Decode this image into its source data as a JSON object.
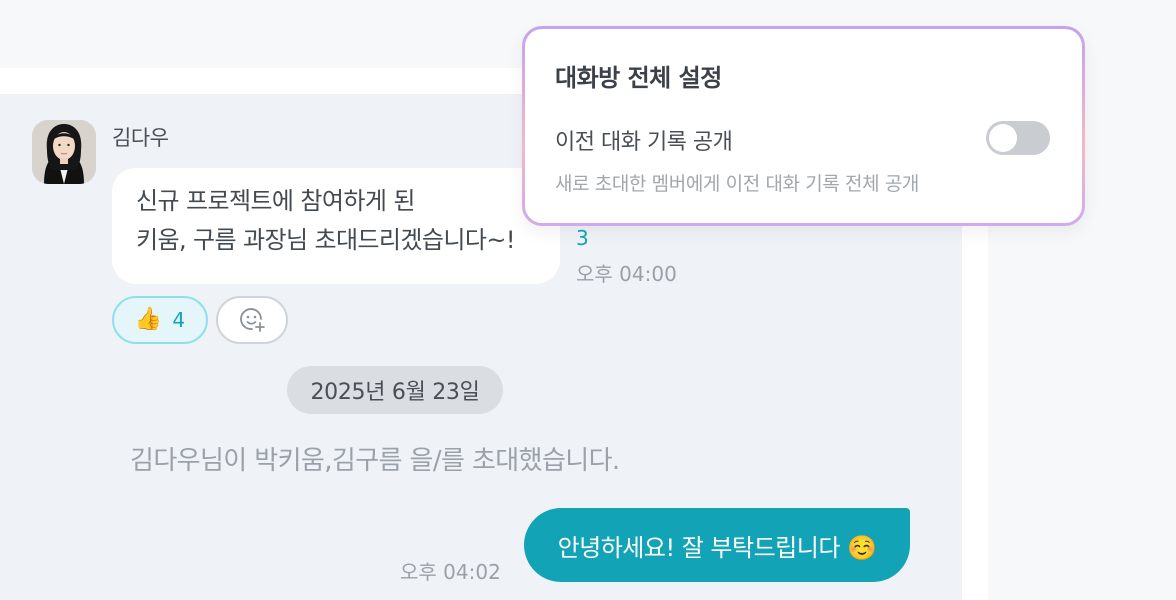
{
  "popover": {
    "title": "대화방 전체 설정",
    "setting": {
      "label": "이전 대화 기록 공개",
      "description": "새로 초대한 멤버에게 이전 대화 기록 전체 공개",
      "enabled": false
    }
  },
  "chat": {
    "message": {
      "sender": "김다우",
      "lines": [
        "신규 프로젝트에 참여하게 된",
        "키움, 구름 과장님 초대드리겠습니다~!"
      ],
      "unread": "3",
      "time": "오후 04:00",
      "reaction": {
        "icon": "thumbs-up-icon",
        "emoji": "👍",
        "count": "4"
      }
    },
    "date_divider": "2025년 6월 23일",
    "system_message": "김다우님이 박키움,김구름 을/를 초대했습니다.",
    "my_message": {
      "text": "안녕하세요! 잘 부탁드립니다 ☺️",
      "time": "오후 04:02"
    }
  },
  "colors": {
    "accent": "#12a3b6",
    "toggle_off": "#c9ccd1",
    "popover_border_top": "#c3a3ee",
    "popover_border_bottom": "#f5b7c7"
  }
}
